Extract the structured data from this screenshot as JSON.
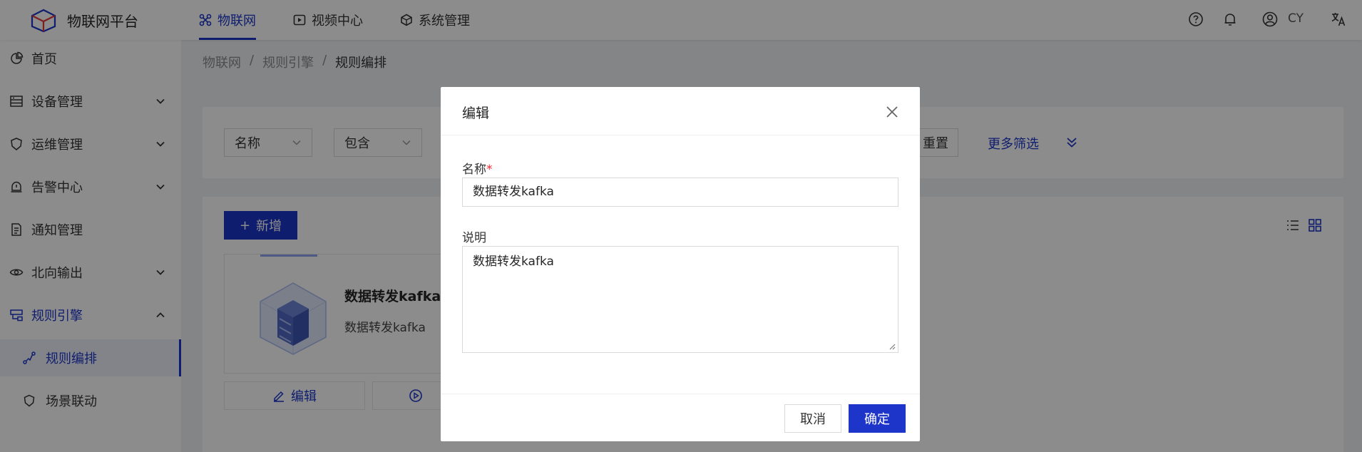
{
  "header": {
    "brand": "物联网平台",
    "nav": [
      {
        "label": "物联网",
        "icon": "iot-icon",
        "active": true
      },
      {
        "label": "视频中心",
        "icon": "video-icon",
        "active": false
      },
      {
        "label": "系统管理",
        "icon": "system-icon",
        "active": false
      }
    ],
    "user": "CY",
    "right_icons": [
      "help-icon",
      "bell-icon",
      "user-avatar-icon",
      "translate-icon"
    ]
  },
  "sidebar": {
    "items": [
      {
        "label": "首页",
        "icon": "pie-chart-icon",
        "expandable": false
      },
      {
        "label": "设备管理",
        "icon": "device-icon",
        "expandable": true
      },
      {
        "label": "运维管理",
        "icon": "ops-icon",
        "expandable": true
      },
      {
        "label": "告警中心",
        "icon": "alarm-icon",
        "expandable": true
      },
      {
        "label": "通知管理",
        "icon": "document-icon",
        "expandable": false
      },
      {
        "label": "北向输出",
        "icon": "eye-icon",
        "expandable": true
      },
      {
        "label": "规则引擎",
        "icon": "rule-icon",
        "expandable": true,
        "expanded": true
      },
      {
        "label": "规则编排",
        "icon": "flow-icon",
        "sub": true,
        "selected": true
      },
      {
        "label": "场景联动",
        "icon": "scene-icon",
        "sub": true
      }
    ]
  },
  "breadcrumb": [
    "物联网",
    "规则引擎",
    "规则编排"
  ],
  "breadcrumb_separator": "/",
  "filter": {
    "field": "名称",
    "operator": "包含",
    "reset_label": "重置",
    "more_label": "更多筛选"
  },
  "list": {
    "add_label": "新增",
    "add_symbol": "+",
    "card": {
      "title": "数据转发kafka",
      "description": "数据转发kafka",
      "edit_label": "编辑"
    }
  },
  "modal": {
    "title": "编辑",
    "name_label": "名称",
    "required_mark": "*",
    "name_value": "数据转发kafka",
    "desc_label": "说明",
    "desc_value": "数据转发kafka",
    "cancel_label": "取消",
    "ok_label": "确定"
  },
  "colors": {
    "primary": "#1d36c9",
    "mask": "rgba(0,0,0,0.45)",
    "required": "#f5222d"
  }
}
